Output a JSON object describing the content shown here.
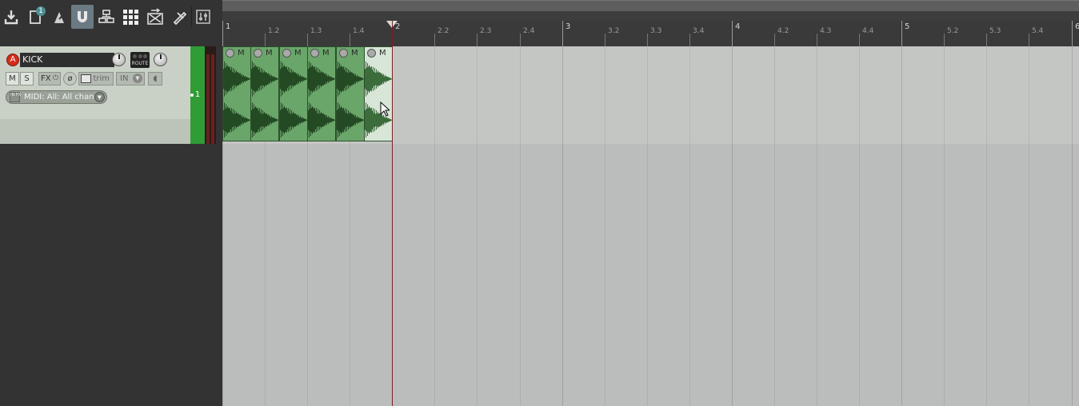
{
  "toolbar": {
    "items": [
      {
        "name": "save-project-icon"
      },
      {
        "name": "project-tabs-icon",
        "badge": "1"
      },
      {
        "name": "metronome-icon"
      },
      {
        "name": "snap-magnet-icon",
        "active": true
      },
      {
        "name": "routing-matrix-icon"
      },
      {
        "name": "grid-icon"
      },
      {
        "name": "ripple-edit-icon"
      },
      {
        "name": "item-properties-icon"
      },
      {
        "name": "mixer-icon"
      }
    ]
  },
  "track": {
    "number": "1",
    "name": "KICK",
    "rec_arm_label": "A",
    "route_label": "ROUTE",
    "mute_label": "M",
    "solo_label": "S",
    "fx_label": "FX",
    "fx_power_glyph": "⏻",
    "phase_glyph": "ø",
    "automation_label": "trim",
    "input_monitor_label": "IN",
    "midi_input_label": "MIDI: All: All chann",
    "midi_io_label": "IN FX",
    "color": "#2f9c36"
  },
  "ruler": {
    "major": [
      {
        "label": "1"
      },
      {
        "label": "2"
      },
      {
        "label": "3"
      },
      {
        "label": "4"
      },
      {
        "label": "5"
      },
      {
        "label": "6"
      }
    ],
    "minor": [
      "1.2",
      "1.3",
      "1.4",
      "2.2",
      "2.3",
      "2.4",
      "3.2",
      "3.3",
      "3.4",
      "4.2",
      "4.3",
      "4.4",
      "5.2",
      "5.3",
      "5.4"
    ]
  },
  "items": [
    {
      "mute_label": "M",
      "selected": false
    },
    {
      "mute_label": "M",
      "selected": false
    },
    {
      "mute_label": "M",
      "selected": false
    },
    {
      "mute_label": "M",
      "selected": false
    },
    {
      "mute_label": "M",
      "selected": false
    },
    {
      "mute_label": "M",
      "selected": true
    }
  ],
  "colors": {
    "item_fill": "#6aa66a",
    "item_selected_fill": "#d8e6d8",
    "edit_cursor": "#7c1f1f",
    "track_color": "#2f9c36"
  }
}
